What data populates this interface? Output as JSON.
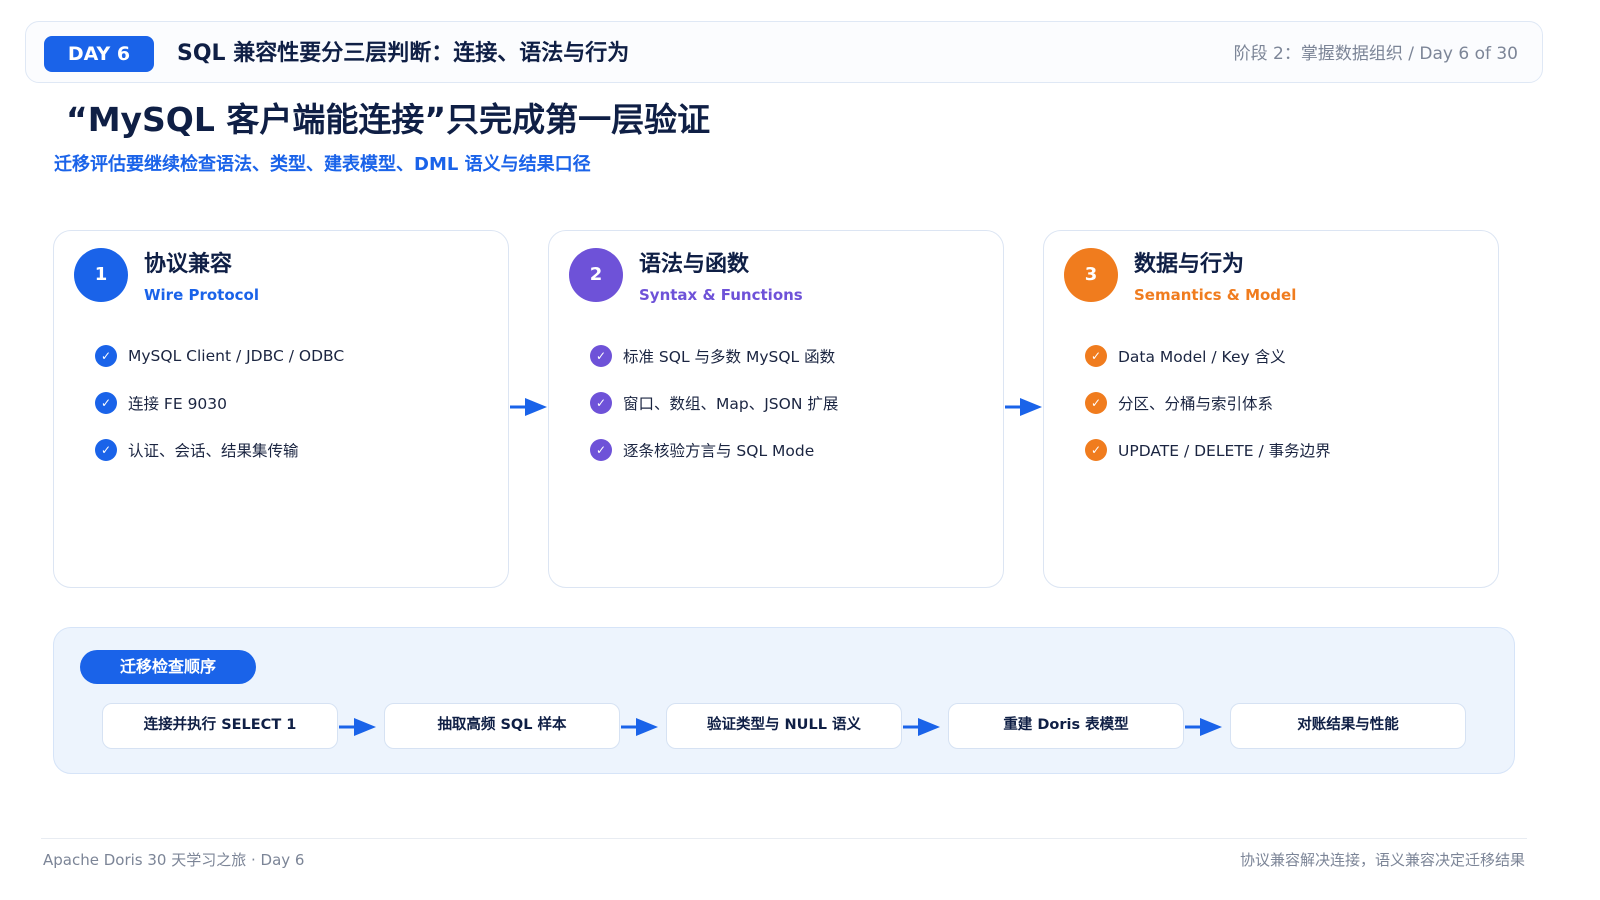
{
  "header": {
    "day_badge": "DAY 6",
    "title": "SQL 兼容性要分三层判断：连接、语法与行为",
    "progress": "阶段 2：掌握数据组织 / Day 6 of 30"
  },
  "main": {
    "title": "“MySQL 客户端能连接”只完成第一层验证",
    "subtitle": "迁移评估要继续检查语法、类型、建表模型、DML 语义与结果口径"
  },
  "cards": [
    {
      "number": "1",
      "title": "协议兼容",
      "subtitle": "Wire Protocol",
      "color": "#1a63e9",
      "items": [
        "MySQL Client / JDBC / ODBC",
        "连接 FE 9030",
        "认证、会话、结果集传输"
      ]
    },
    {
      "number": "2",
      "title": "语法与函数",
      "subtitle": "Syntax & Functions",
      "color": "#6e52d8",
      "items": [
        "标准 SQL 与多数 MySQL 函数",
        "窗口、数组、Map、JSON 扩展",
        "逐条核验方言与 SQL Mode"
      ]
    },
    {
      "number": "3",
      "title": "数据与行为",
      "subtitle": "Semantics & Model",
      "color": "#f07c1e",
      "items": [
        "Data Model / Key 含义",
        "分区、分桶与索引体系",
        "UPDATE / DELETE / 事务边界"
      ]
    }
  ],
  "process": {
    "label": "迁移检查顺序",
    "steps": [
      "连接并执行 SELECT 1",
      "抽取高频 SQL 样本",
      "验证类型与 NULL 语义",
      "重建 Doris 表模型",
      "对账结果与性能"
    ]
  },
  "icons": {
    "check": "check-icon",
    "arrow": "arrow-right-icon"
  },
  "footer": {
    "left": "Apache Doris 30 天学习之旅 · Day 6",
    "right": "协议兼容解决连接，语义兼容决定迁移结果"
  }
}
